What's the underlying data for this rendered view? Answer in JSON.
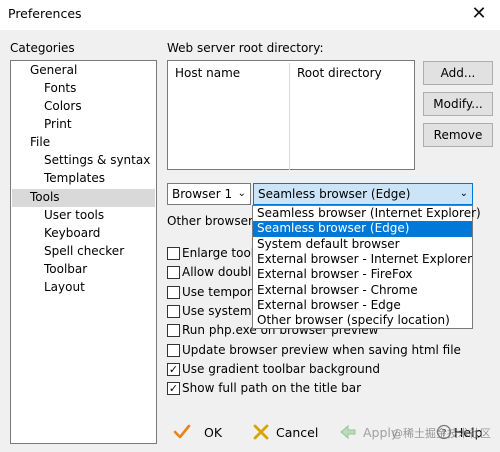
{
  "window": {
    "title": "Preferences",
    "close_glyph": "✕"
  },
  "categories": {
    "label": "Categories",
    "items": [
      {
        "label": "General",
        "level": 0
      },
      {
        "label": "Fonts",
        "level": 1
      },
      {
        "label": "Colors",
        "level": 1
      },
      {
        "label": "Print",
        "level": 1
      },
      {
        "label": "File",
        "level": 0
      },
      {
        "label": "Settings & syntax",
        "level": 1
      },
      {
        "label": "Templates",
        "level": 1
      },
      {
        "label": "Tools",
        "level": 0,
        "selected": true
      },
      {
        "label": "User tools",
        "level": 1
      },
      {
        "label": "Keyboard",
        "level": 1
      },
      {
        "label": "Spell checker",
        "level": 1
      },
      {
        "label": "Toolbar",
        "level": 1
      },
      {
        "label": "Layout",
        "level": 1
      }
    ]
  },
  "webserver": {
    "label": "Web server root directory:",
    "columns": [
      "Host name",
      "Root directory"
    ],
    "buttons": {
      "add": "Add...",
      "modify": "Modify...",
      "remove": "Remove"
    }
  },
  "browser": {
    "number_select": "Browser 1",
    "type_select": "Seamless browser (Edge)",
    "other_label": "Other browser:",
    "options": [
      "Seamless browser (Internet Explorer)",
      "Seamless browser (Edge)",
      "System default browser",
      "External browser - Internet Explorer",
      "External browser - FireFox",
      "External browser - Chrome",
      "External browser - Edge",
      "Other browser (specify location)"
    ],
    "highlighted_index": 1
  },
  "checkboxes": [
    {
      "label": "Enlarge toolb",
      "checked": false
    },
    {
      "label": "Allow double-",
      "checked": false
    },
    {
      "label": "Use tempora",
      "checked": false
    },
    {
      "label": "Use system d",
      "checked": false
    },
    {
      "label": "Run php.exe on browser preview",
      "checked": false
    },
    {
      "label": "Update browser preview when saving html file",
      "checked": false
    },
    {
      "label": "Use gradient toolbar background",
      "checked": true
    },
    {
      "label": "Show full path on the title bar",
      "checked": true
    }
  ],
  "footer": {
    "ok": "OK",
    "cancel": "Cancel",
    "apply": "Apply",
    "help": "Help",
    "watermark": "@稀土掘金技术社区"
  },
  "colors": {
    "accent": "#0078d7",
    "ok_check": "#e8821c",
    "cancel_x": "#d9a400"
  }
}
